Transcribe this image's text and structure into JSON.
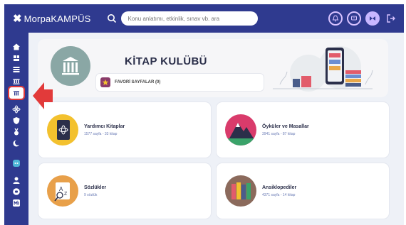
{
  "app": {
    "logo_text": "MorpaKAMPÜS"
  },
  "search": {
    "placeholder": "Konu anlatımı, etkinlik, sınav vb. ara"
  },
  "hero": {
    "title": "KİTAP KULÜBÜ",
    "favorites_label": "FAVORİ SAYFALAR (0)"
  },
  "cards": [
    {
      "title": "Yardımcı Kitaplar",
      "subtitle": "1577 sayfa - 33 kitap"
    },
    {
      "title": "Öyküler ve Masallar",
      "subtitle": "3941 sayfa - 87 kitap"
    },
    {
      "title": "Sözlükler",
      "subtitle": "9 sözlük"
    },
    {
      "title": "Ansiklopediler",
      "subtitle": "4371 sayfa - 14 kitap"
    }
  ],
  "colors": {
    "topbar": "#2f3a8f",
    "accent_red": "#e23a3a",
    "card_link": "#6a7bb5"
  }
}
